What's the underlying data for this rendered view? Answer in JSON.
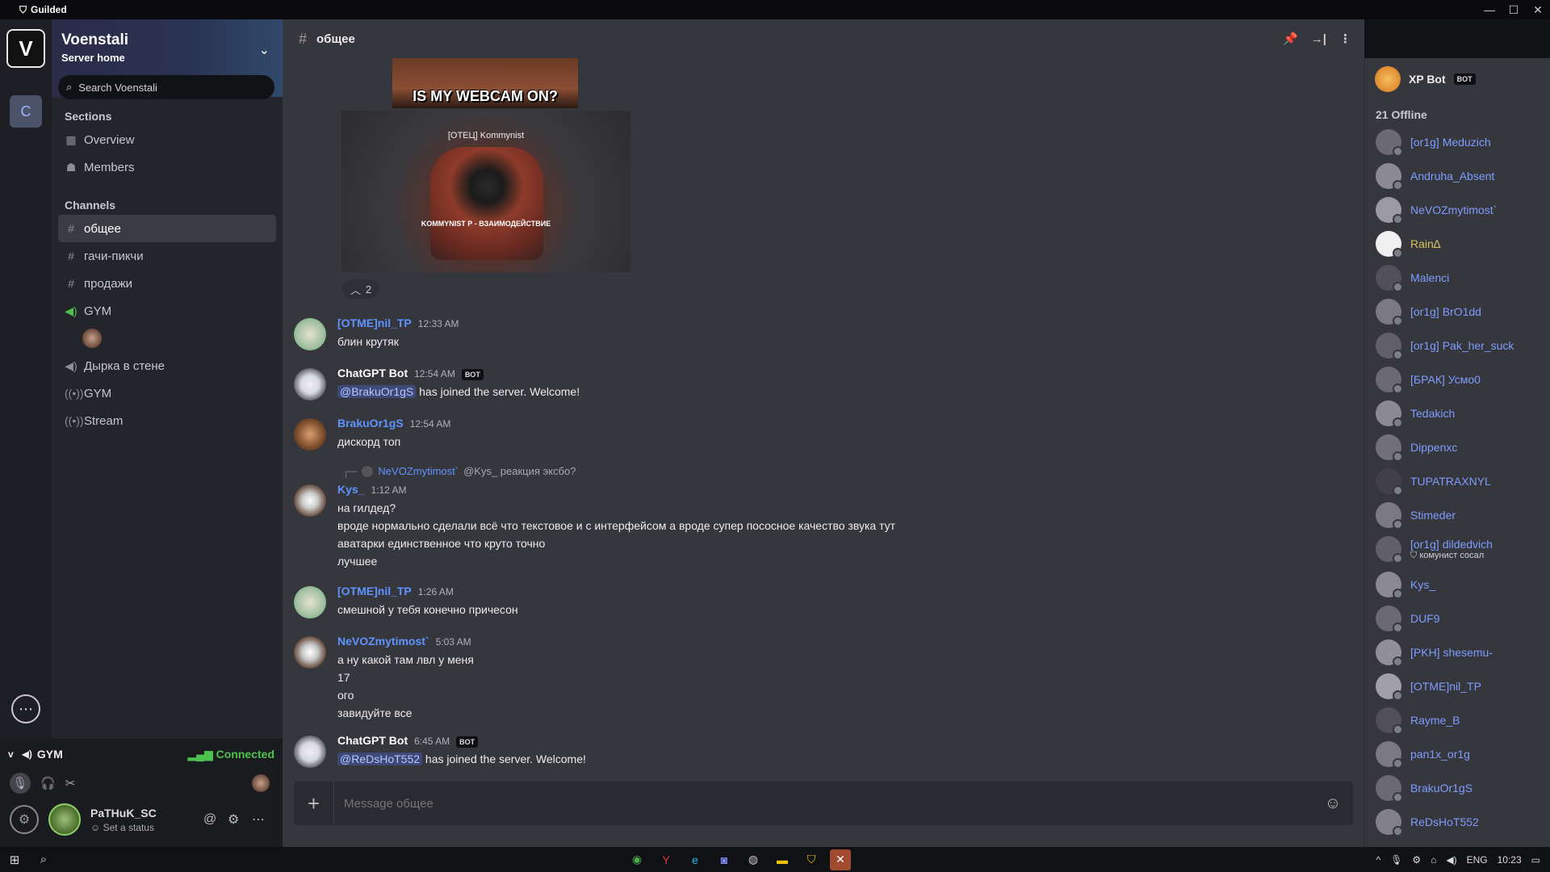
{
  "app": {
    "name": "Guilded"
  },
  "window_controls": {
    "minimize": "—",
    "maximize": "☐",
    "close": "✕"
  },
  "rail": {
    "server1_letter": "V",
    "server2_letter": "C"
  },
  "server": {
    "name": "Voenstali",
    "subtitle": "Server home",
    "search_placeholder": "Search Voenstali"
  },
  "sidebar": {
    "sections_header": "Sections",
    "sections": [
      {
        "label": "Overview",
        "icon": "grid-icon"
      },
      {
        "label": "Members",
        "icon": "members-icon"
      }
    ],
    "channels_header": "Channels",
    "channels": [
      {
        "label": "общее",
        "icon": "hash-icon",
        "active": true
      },
      {
        "label": "гачи-пикчи",
        "icon": "hash-icon"
      },
      {
        "label": "продажи",
        "icon": "hash-icon"
      },
      {
        "label": "GYM",
        "icon": "voice-icon"
      },
      {
        "label": "Дырка в стене",
        "icon": "voice-icon"
      },
      {
        "label": "GYM",
        "icon": "stream-icon"
      },
      {
        "label": "Stream",
        "icon": "stream-icon"
      }
    ]
  },
  "voice": {
    "channel": "GYM",
    "status": "Connected",
    "user": {
      "name": "PaTHuK_SC",
      "status": "Set a status"
    }
  },
  "channel_header": {
    "name": "общее"
  },
  "media": {
    "meme_text": "IS MY WEBCAM ON?",
    "screenshot_caption": "[ОТЕЦ] Kommynist",
    "screenshot_caption2": "KOMMYNIST\nР - ВЗАИМОДЕЙСТВИЕ",
    "reaction_count": "2"
  },
  "messages": [
    {
      "author": "[OTME]nil_TP",
      "time": "12:33 AM",
      "lines": [
        "блин крутяк"
      ]
    },
    {
      "author": "ChatGPT Bot",
      "time": "12:54 AM",
      "badge": "BOT",
      "mention": "@BrakuOr1gS",
      "text": "has joined the server. Welcome!"
    },
    {
      "author": "BrakuOr1gS",
      "time": "12:54 AM",
      "lines": [
        "дискорд топ"
      ]
    },
    {
      "reply_author": "NeVOZmytimost`",
      "reply_text": "@Kys_ реакция эксбо?",
      "author": "Kys_",
      "time": "1:12 AM",
      "lines": [
        "на гилдед?",
        "вроде нормально сделали всё что текстовое и с интерфейсом а вроде супер посоcное качество звука тут",
        "аватарки единственное что круто точно",
        "лучшее"
      ]
    },
    {
      "author": "[OTME]nil_TP",
      "time": "1:26 AM",
      "lines": [
        "смешной у тебя конечно причесон"
      ]
    },
    {
      "author": "NeVOZmytimost`",
      "time": "5:03 AM",
      "lines": [
        "а ну какой там лвл у меня",
        "17",
        "ого",
        "завидуйте все"
      ]
    },
    {
      "author": "ChatGPT Bot",
      "time": "6:45 AM",
      "badge": "BOT",
      "mention": "@ReDsHoT552",
      "text": "has joined the server. Welcome!"
    }
  ],
  "composer": {
    "placeholder": "Message общее"
  },
  "members_panel": {
    "bot": {
      "name": "XP Bot",
      "badge": "BOT"
    },
    "offline_count": "21",
    "offline_label": "Offline",
    "members": [
      "[or1g] Meduzich",
      "Andruha_Absent",
      "NeVOZmytimost`",
      "Rain∆",
      "Malenci",
      "[or1g] BrO1dd",
      "[or1g] Pak_her_suck",
      "[БРАК] Усмо0",
      "Tedakich",
      "Dippenxc",
      "TUPATRAXNYL",
      "Stimeder",
      "[or1g] dildedvich",
      "Kys_",
      "DUF9",
      "[PKH] shesemu-",
      "[OTME]nil_TP",
      "Rayme_B",
      "pan1x_or1g",
      "BrakuOr1gS",
      "ReDsHoT552"
    ],
    "status_sub": "комунист сосал"
  },
  "taskbar": {
    "lang": "ENG",
    "time": "10:23"
  },
  "colors": {
    "accent_blue": "#5e93ff",
    "connected_green": "#4ec24e",
    "guilded_yellow": "#f5c400"
  }
}
